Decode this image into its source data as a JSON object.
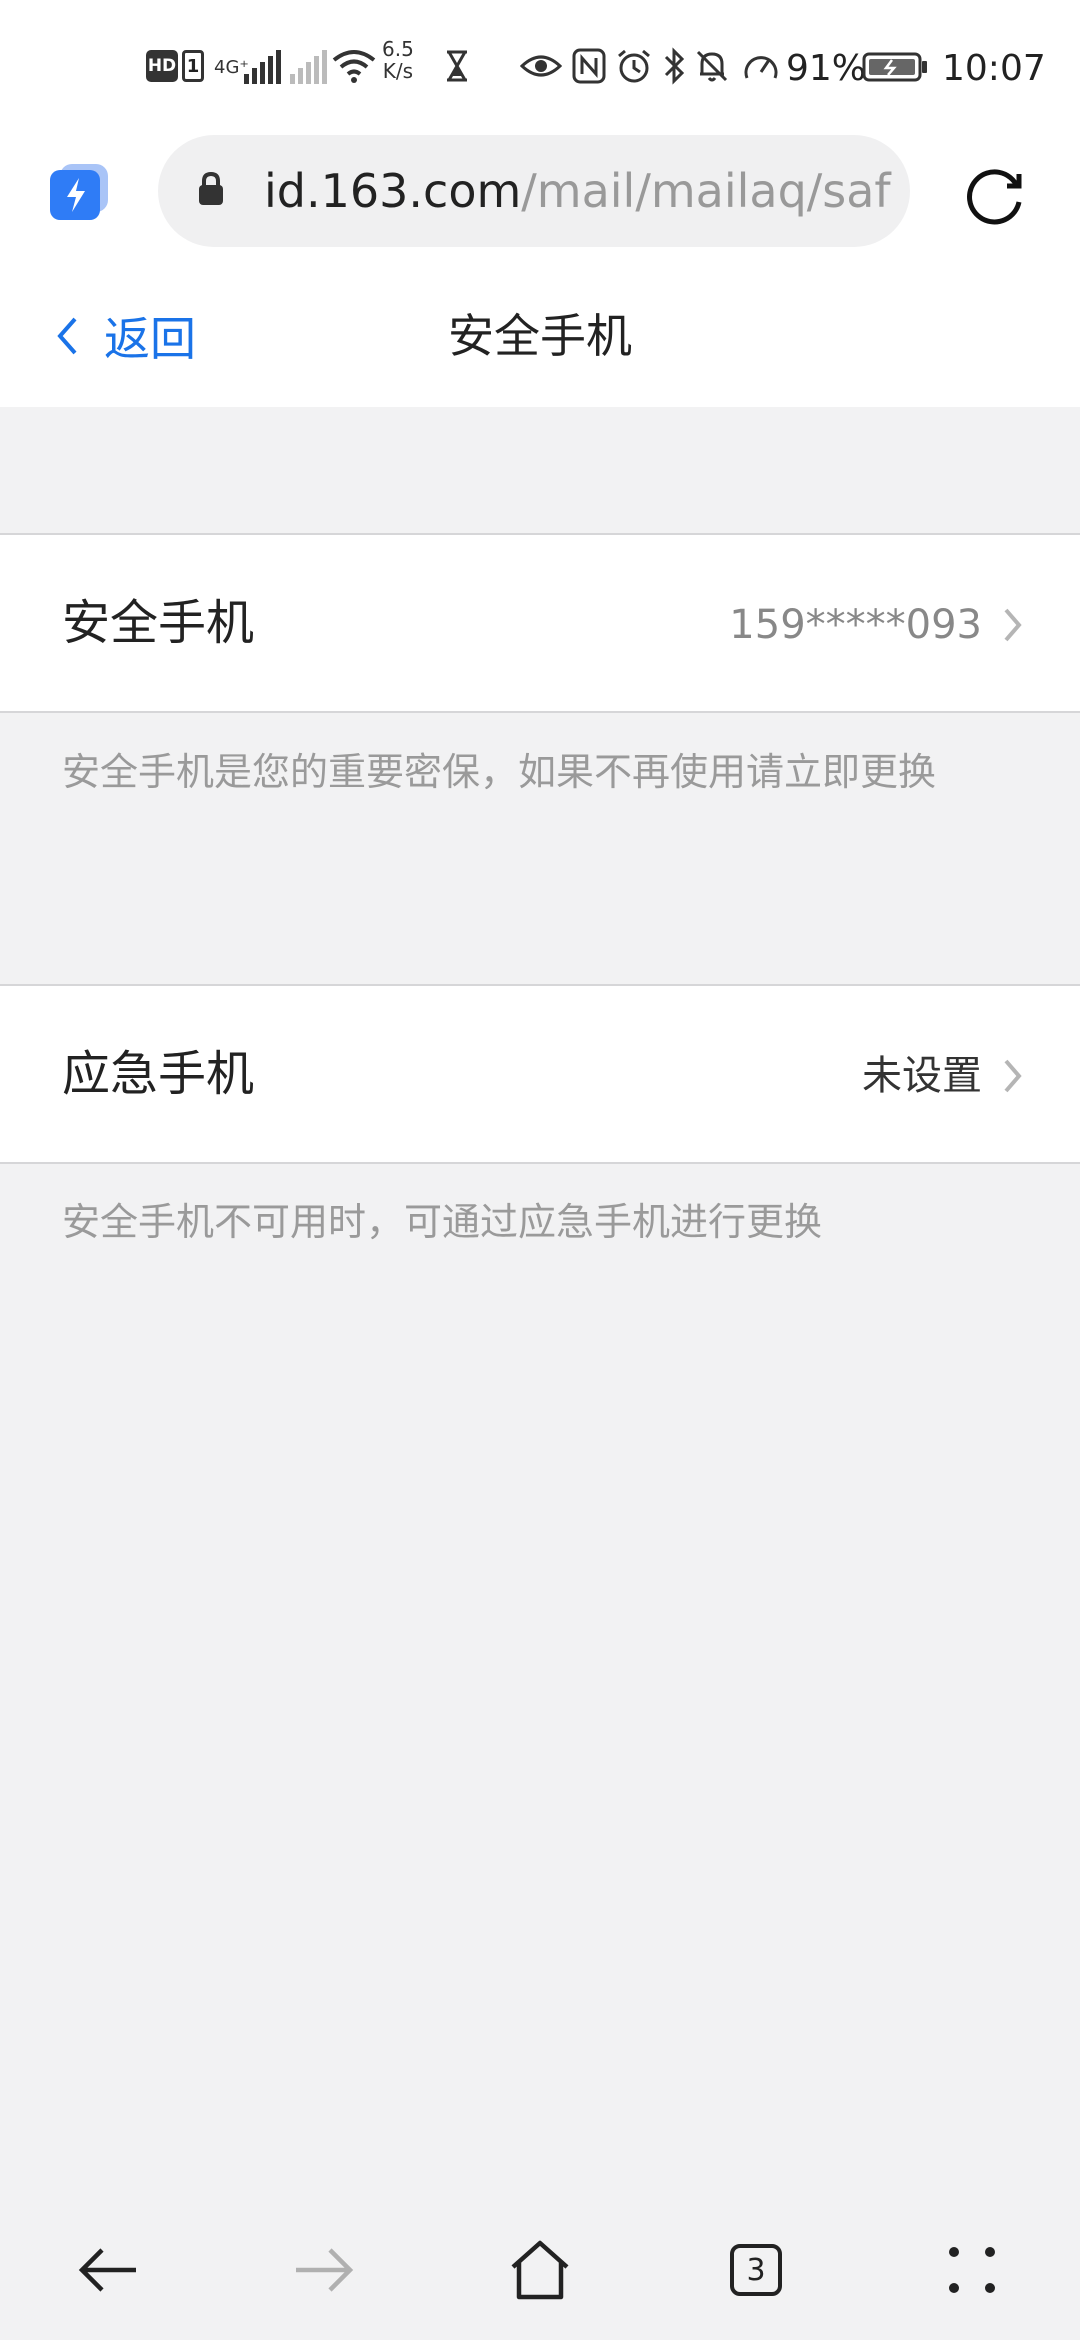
{
  "status_bar": {
    "hd_label": "HD",
    "sim_label": "1",
    "network_type": "4G⁺",
    "speed_value": "6.5",
    "speed_unit": "K/s",
    "battery_percent": "91%",
    "time": "10:07"
  },
  "browser": {
    "url_host": "id.163.com",
    "url_path": "/mail/mailaq/safeMobile",
    "tab_count": "3"
  },
  "header": {
    "back_label": "返回",
    "title": "安全手机",
    "accent_color": "#1a73e8"
  },
  "security_phone": {
    "label": "安全手机",
    "value": "159*****093",
    "hint": "安全手机是您的重要密保，如果不再使用请立即更换"
  },
  "emergency_phone": {
    "label": "应急手机",
    "value": "未设置",
    "hint": "安全手机不可用时，可通过应急手机进行更换"
  },
  "icons": [
    "lightning-app-icon",
    "lock-icon",
    "reload-icon",
    "back-chevron-icon",
    "chevron-right-icon",
    "back-arrow-icon",
    "forward-arrow-icon",
    "home-icon",
    "tabs-icon",
    "menu-dots-icon"
  ]
}
